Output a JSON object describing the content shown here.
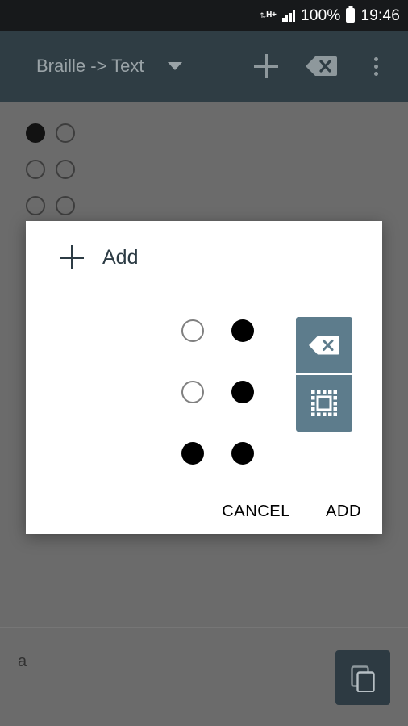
{
  "status_bar": {
    "network_type": "H+",
    "network_arrows": "⇅",
    "signal_icon": "signal-bars-icon",
    "battery_percent": "100%",
    "battery_icon": "battery-full-icon",
    "time": "19:46"
  },
  "app_bar": {
    "mode_title": "Braille -> Text",
    "dropdown_icon": "chevron-down-icon",
    "add_icon": "plus-icon",
    "backspace_icon": "backspace-icon",
    "overflow_icon": "overflow-menu-icon"
  },
  "content": {
    "background_braille": {
      "label": "braille-cell-a",
      "dots": [
        {
          "position": 1,
          "filled": true
        },
        {
          "position": 4,
          "filled": false
        },
        {
          "position": 2,
          "filled": false
        },
        {
          "position": 5,
          "filled": false
        },
        {
          "position": 3,
          "filled": false
        },
        {
          "position": 6,
          "filled": false
        }
      ]
    },
    "output_text": "a",
    "copy_button_icon": "copy-icon"
  },
  "dialog": {
    "title": "Add",
    "title_icon": "plus-icon",
    "braille_input": {
      "label": "braille-cell-editor",
      "dots": [
        {
          "position": 1,
          "filled": false
        },
        {
          "position": 4,
          "filled": true
        },
        {
          "position": 2,
          "filled": false
        },
        {
          "position": 5,
          "filled": true
        },
        {
          "position": 3,
          "filled": true
        },
        {
          "position": 6,
          "filled": true
        }
      ]
    },
    "side_buttons": [
      {
        "icon": "backspace-icon",
        "name": "dialog-backspace-button"
      },
      {
        "icon": "select-all-icon",
        "name": "dialog-clear-button"
      }
    ],
    "cancel_label": "CANCEL",
    "add_label": "ADD"
  },
  "colors": {
    "status_bar_bg": "#17191b",
    "app_bar_bg": "#2f3d44",
    "scrim_bg": "#6b6b6b",
    "dialog_bg": "#ffffff",
    "accent_slate": "#5d7c8c",
    "fab_bg": "#2d3a42",
    "title_text": "#2c3b44"
  }
}
